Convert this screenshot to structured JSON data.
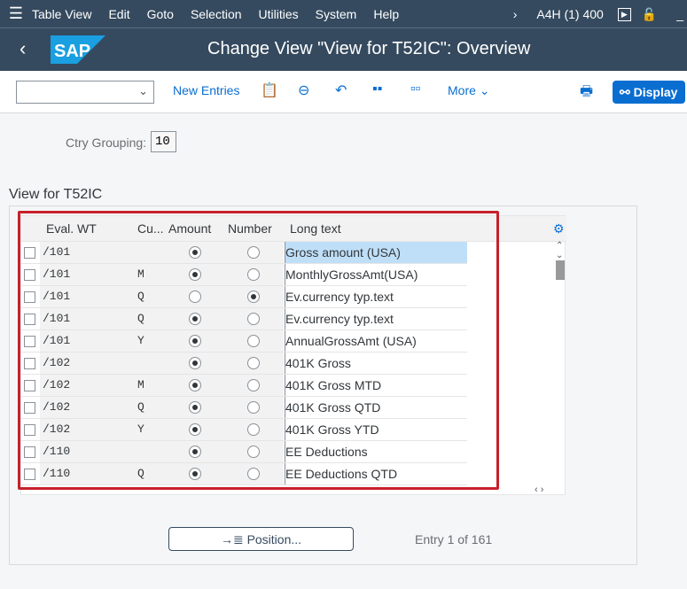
{
  "menubar": {
    "items": [
      "Table View",
      "Edit",
      "Goto",
      "Selection",
      "Utilities",
      "System",
      "Help"
    ],
    "system_info": "A4H (1) 400"
  },
  "titlebar": {
    "logo": "SAP",
    "title": "Change View \"View for T52IC\": Overview"
  },
  "toolbar": {
    "new_entries": "New Entries",
    "more": "More",
    "display": "Display",
    "select_value": ""
  },
  "filter": {
    "label": "Ctry Grouping:",
    "value": "10"
  },
  "section": {
    "title": "View for T52IC"
  },
  "table": {
    "columns": [
      "Eval. WT",
      "Cu...",
      "Amount",
      "Number",
      "Long text"
    ],
    "rows": [
      {
        "wt": "/101",
        "cu": "",
        "amount": true,
        "number": false,
        "text": "Gross amount (USA)",
        "selected": true
      },
      {
        "wt": "/101",
        "cu": "M",
        "amount": true,
        "number": false,
        "text": "MonthlyGrossAmt(USA)"
      },
      {
        "wt": "/101",
        "cu": "Q",
        "amount": false,
        "number": true,
        "text": "Ev.currency typ.text"
      },
      {
        "wt": "/101",
        "cu": "Q",
        "amount": true,
        "number": false,
        "text": "Ev.currency typ.text"
      },
      {
        "wt": "/101",
        "cu": "Y",
        "amount": true,
        "number": false,
        "text": "AnnualGrossAmt (USA)"
      },
      {
        "wt": "/102",
        "cu": "",
        "amount": true,
        "number": false,
        "text": "401K Gross"
      },
      {
        "wt": "/102",
        "cu": "M",
        "amount": true,
        "number": false,
        "text": "401K Gross MTD"
      },
      {
        "wt": "/102",
        "cu": "Q",
        "amount": true,
        "number": false,
        "text": "401K Gross QTD"
      },
      {
        "wt": "/102",
        "cu": "Y",
        "amount": true,
        "number": false,
        "text": "401K Gross YTD"
      },
      {
        "wt": "/110",
        "cu": "",
        "amount": true,
        "number": false,
        "text": "EE Deductions"
      },
      {
        "wt": "/110",
        "cu": "Q",
        "amount": true,
        "number": false,
        "text": "EE Deductions QTD"
      }
    ]
  },
  "footer": {
    "position_button": "Position...",
    "entry_info": "Entry 1 of 161"
  }
}
